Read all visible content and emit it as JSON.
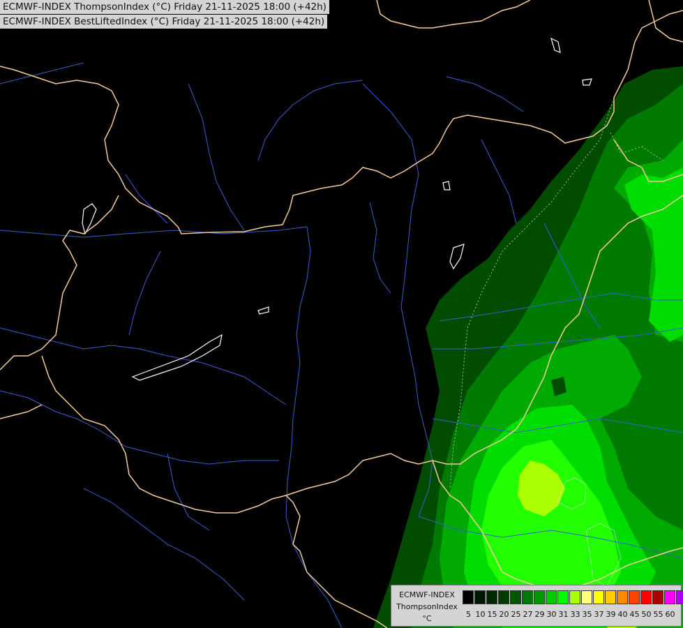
{
  "header": {
    "line1": "ECMWF-INDEX ThompsonIndex (°C) Friday 21-11-2025 18:00 (+42h)",
    "line2": "ECMWF-INDEX BestLiftedIndex (°C) Friday 21-11-2025 18:00 (+42h)"
  },
  "legend": {
    "line1": "ECMWF-INDEX",
    "line2": "ThompsonIndex",
    "line3": "°C",
    "ticks": [
      "5",
      "10",
      "15",
      "20",
      "25",
      "27",
      "29",
      "30",
      "31",
      "33",
      "35",
      "37",
      "39",
      "40",
      "45",
      "50",
      "55",
      "60"
    ],
    "colors": [
      "#000000",
      "#001800",
      "#002800",
      "#003c00",
      "#005500",
      "#007700",
      "#009900",
      "#00cc00",
      "#00ff00",
      "#aaff00",
      "#ffff80",
      "#ffff00",
      "#ffcc00",
      "#ff8800",
      "#ff4400",
      "#ff0000",
      "#aa0000",
      "#ff00ff",
      "#aa00ff",
      "#5500ff",
      "#0000ff"
    ],
    "layer_colors": {
      "l20": "#004d00",
      "l25": "#007a00",
      "l27": "#00aa00",
      "l29": "#00dd00",
      "l30": "#22ff00",
      "l31": "#aaff00"
    }
  },
  "map_style": {
    "background": "#000000",
    "border_color": "#f5cc9a",
    "river_color": "#3a5fcd",
    "lake_color": "#ffffff"
  }
}
